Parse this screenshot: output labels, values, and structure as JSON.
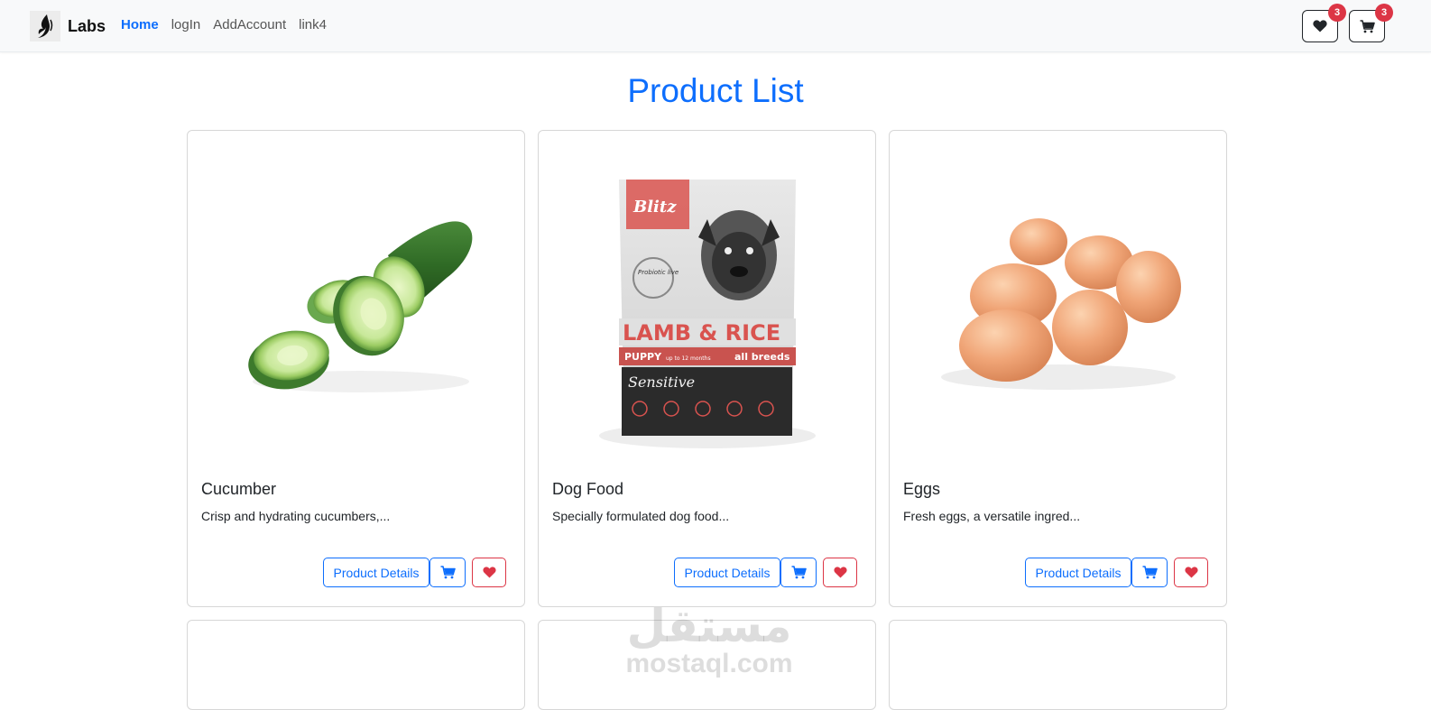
{
  "navbar": {
    "brand": "Labs",
    "links": [
      {
        "label": "Home",
        "active": true
      },
      {
        "label": "logIn",
        "active": false
      },
      {
        "label": "AddAccount",
        "active": false
      },
      {
        "label": "link4",
        "active": false
      }
    ],
    "wishlist_count": "3",
    "cart_count": "3"
  },
  "page": {
    "title": "Product List"
  },
  "products": [
    {
      "name": "Cucumber",
      "description": "Crisp and hydrating cucumbers,...",
      "details_label": "Product Details",
      "image_icon": "cucumber-image"
    },
    {
      "name": "Dog Food",
      "description": "Specially formulated dog food...",
      "details_label": "Product Details",
      "image_icon": "dog-food-bag-image",
      "package": {
        "brand": "Blitz",
        "probiotic": "Probiotic live",
        "flavor": "LAMB & RICE",
        "age": "PUPPY",
        "age_note": "up to 12 months",
        "breeds": "all breeds",
        "line": "Sensitive"
      }
    },
    {
      "name": "Eggs",
      "description": "Fresh eggs, a versatile ingred...",
      "details_label": "Product Details",
      "image_icon": "eggs-image"
    }
  ],
  "watermark": {
    "arabic": "مستقل",
    "latin": "mostaql.com"
  },
  "colors": {
    "primary": "#0d6efd",
    "danger": "#dc3545",
    "navbar_bg": "#f8f9fa"
  }
}
